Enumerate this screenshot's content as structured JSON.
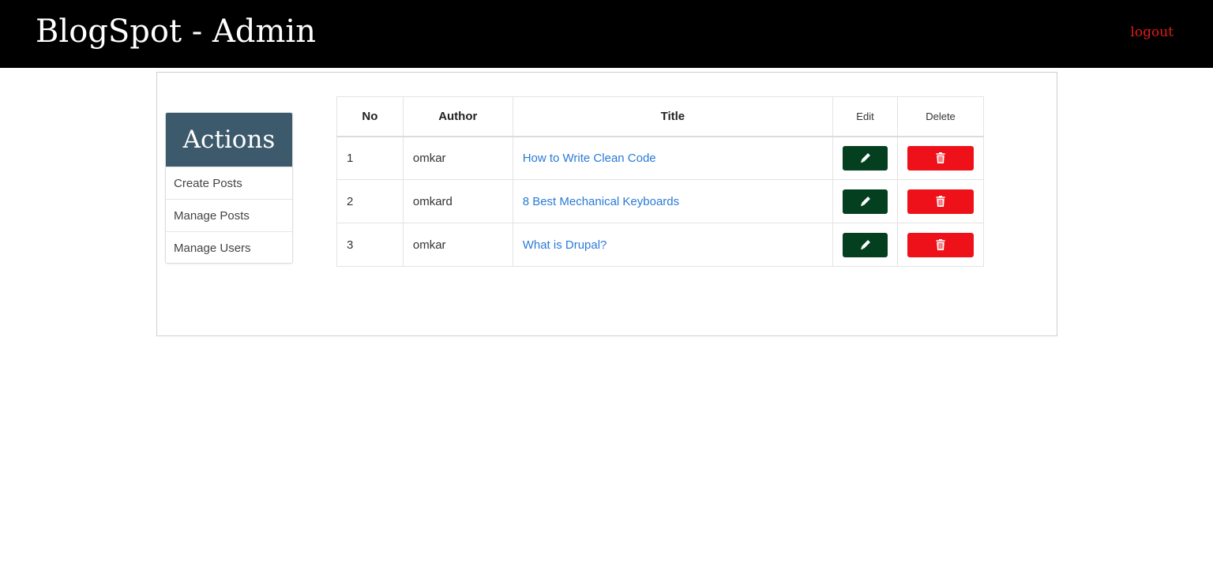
{
  "header": {
    "brand": "BlogSpot - Admin",
    "logout_label": "logout"
  },
  "sidebar": {
    "title": "Actions",
    "items": [
      {
        "label": "Create Posts"
      },
      {
        "label": "Manage Posts"
      },
      {
        "label": "Manage Users"
      }
    ]
  },
  "table": {
    "columns": [
      "No",
      "Author",
      "Title",
      "Edit",
      "Delete"
    ],
    "rows": [
      {
        "no": "1",
        "author": "omkar",
        "title": "How to Write Clean Code"
      },
      {
        "no": "2",
        "author": "omkard",
        "title": "8 Best Mechanical Keyboards"
      },
      {
        "no": "3",
        "author": "omkar",
        "title": "What is Drupal?"
      }
    ]
  },
  "icons": {
    "edit": "pencil-icon",
    "delete": "trash-icon"
  },
  "colors": {
    "topbar": "#000000",
    "logout": "#e31a1a",
    "actions_header": "#3c5a6b",
    "edit_button": "#043f1f",
    "delete_button": "#ee1119",
    "link": "#2a7ad6"
  }
}
